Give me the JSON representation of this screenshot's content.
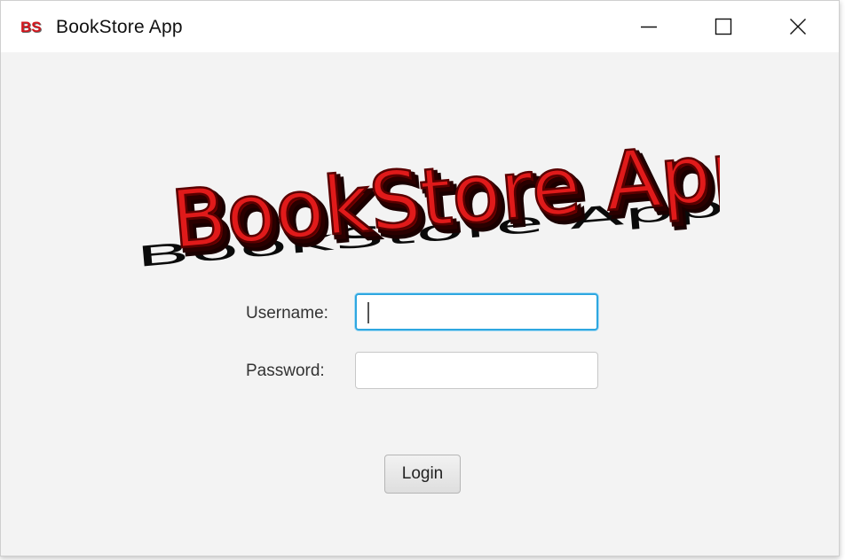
{
  "window": {
    "title": "BookStore App",
    "icon": "bs-app-icon",
    "icon_text": "BS",
    "controls": {
      "minimize_icon": "minimize-icon",
      "maximize_icon": "maximize-icon",
      "close_icon": "close-icon"
    }
  },
  "logo": {
    "text": "BookStore App",
    "color": "#e01a1a"
  },
  "form": {
    "username_label": "Username:",
    "username_value": "",
    "password_label": "Password:",
    "password_value": "",
    "login_label": "Login"
  },
  "colors": {
    "focus_border": "#2ea7e0",
    "window_bg": "#f3f3f3"
  }
}
